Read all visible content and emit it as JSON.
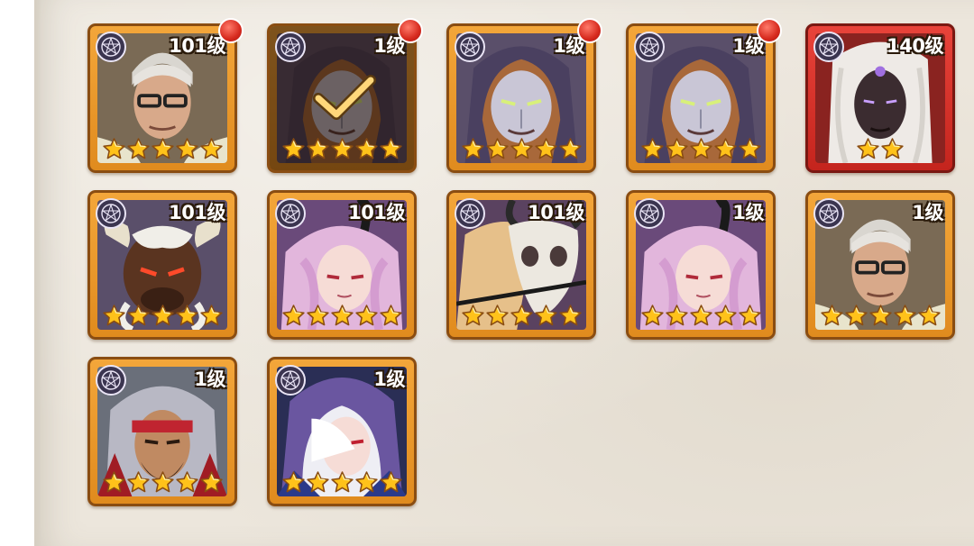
{
  "heroes": [
    {
      "id": "h1",
      "level": "101级",
      "stars": 5,
      "frame": "orange",
      "face": "old-man-glasses",
      "notify": true,
      "selected": false
    },
    {
      "id": "h2",
      "level": "1级",
      "stars": 5,
      "frame": "orange",
      "face": "masked-hooded",
      "notify": true,
      "selected": true
    },
    {
      "id": "h3",
      "level": "1级",
      "stars": 5,
      "frame": "orange",
      "face": "masked-hooded",
      "notify": true,
      "selected": false
    },
    {
      "id": "h4",
      "level": "1级",
      "stars": 5,
      "frame": "orange",
      "face": "masked-hooded",
      "notify": true,
      "selected": false
    },
    {
      "id": "h5",
      "level": "140级",
      "stars": 2,
      "frame": "red",
      "face": "white-hair-dark-skin",
      "notify": false,
      "selected": false
    },
    {
      "id": "h6",
      "level": "101级",
      "stars": 5,
      "frame": "orange",
      "face": "minotaur",
      "notify": false,
      "selected": false
    },
    {
      "id": "h7",
      "level": "101级",
      "stars": 5,
      "frame": "orange",
      "face": "pink-hair-horns",
      "notify": false,
      "selected": false
    },
    {
      "id": "h8",
      "level": "101级",
      "stars": 5,
      "frame": "orange",
      "face": "skull-mask-blonde",
      "notify": false,
      "selected": false
    },
    {
      "id": "h9",
      "level": "1级",
      "stars": 5,
      "frame": "orange",
      "face": "pink-hair-horns",
      "notify": false,
      "selected": false
    },
    {
      "id": "h10",
      "level": "1级",
      "stars": 5,
      "frame": "orange",
      "face": "old-man-glasses",
      "notify": false,
      "selected": false
    },
    {
      "id": "h11",
      "level": "1级",
      "stars": 5,
      "frame": "orange",
      "face": "hooded-bearded-warrior",
      "notify": false,
      "selected": false
    },
    {
      "id": "h12",
      "level": "1级",
      "stars": 5,
      "frame": "orange",
      "face": "purple-hood-white-hair",
      "notify": false,
      "selected": false
    }
  ],
  "icons": {
    "faction": "pentagram-emblem-icon",
    "star": "gold-star-icon",
    "check": "checkmark-icon",
    "notify": "red-dot-badge"
  },
  "colors": {
    "frame_orange": "#e8951f",
    "frame_red": "#d0322a",
    "panel": "#ece6dc",
    "star": "#ffc21a"
  }
}
